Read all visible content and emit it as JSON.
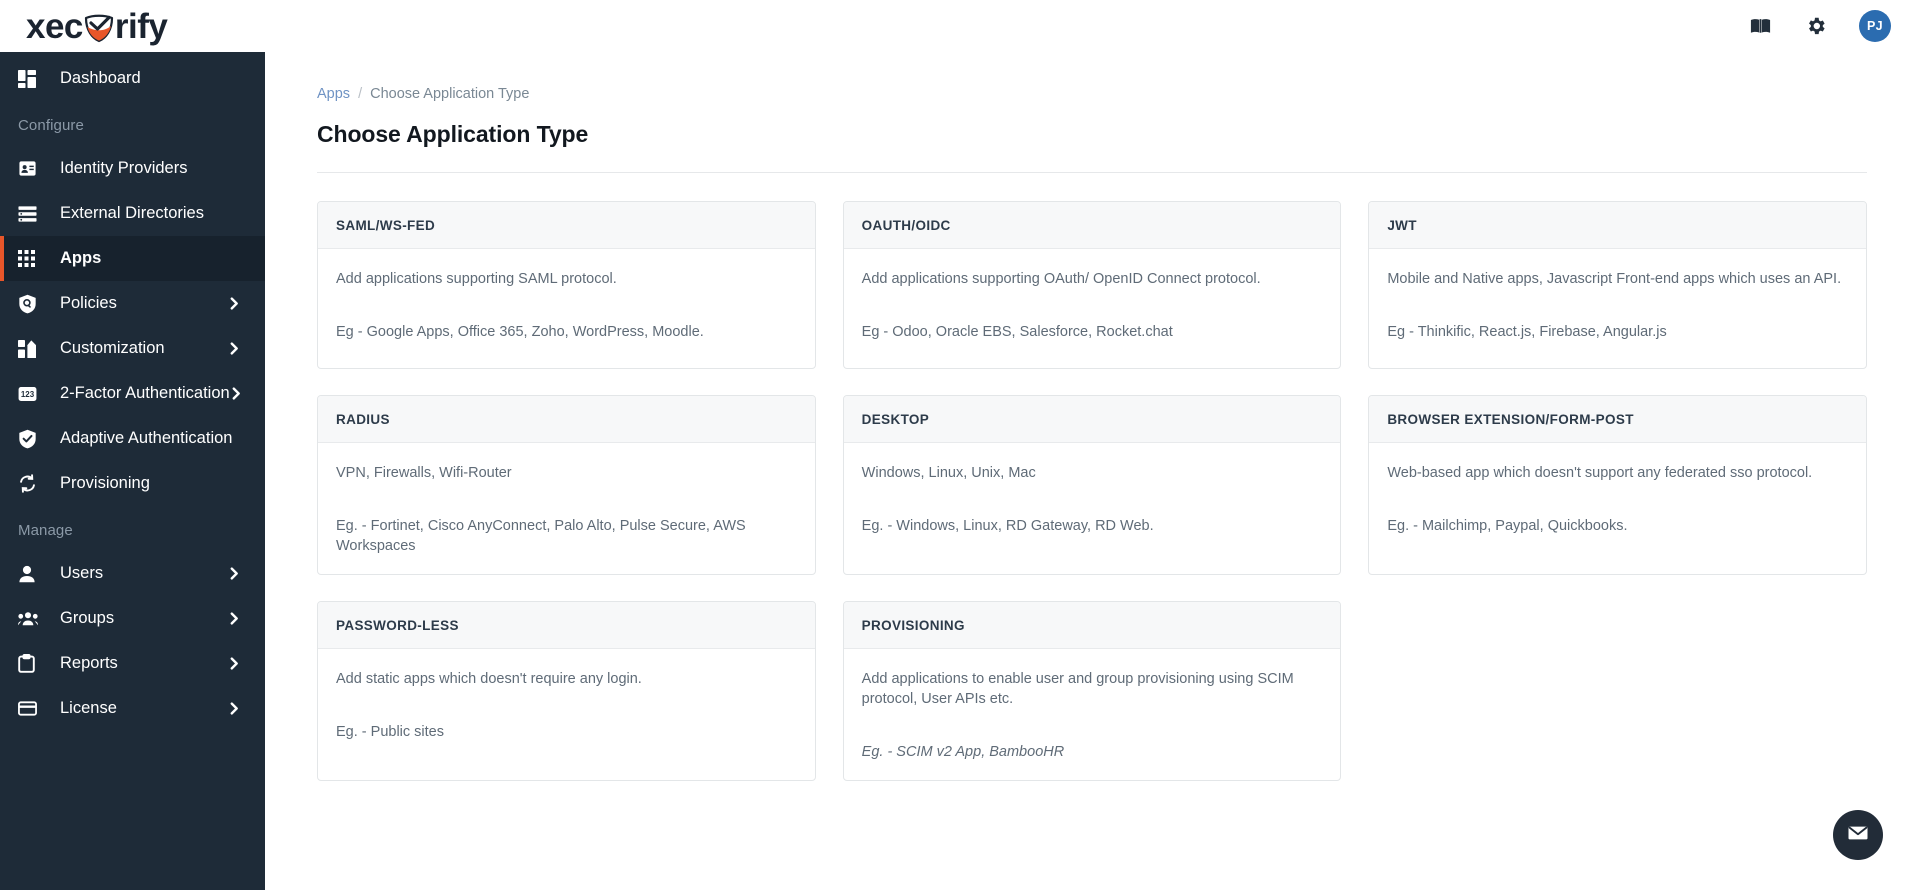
{
  "brand": {
    "name_part1": "xec",
    "name_part2": "rify",
    "shield_color": "#e8562a",
    "accent_color": "#e8562a"
  },
  "topbar": {
    "docs_icon": "book-icon",
    "settings_icon": "gear-icon",
    "avatar_initials": "PJ",
    "avatar_color": "#2b6cb0"
  },
  "sidebar": {
    "items": [
      {
        "label": "Dashboard",
        "icon": "dashboard-icon",
        "chevron": false,
        "active": false
      },
      {
        "label": "Identity Providers",
        "icon": "id-card-icon",
        "chevron": false,
        "active": false
      },
      {
        "label": "External Directories",
        "icon": "list-icon",
        "chevron": false,
        "active": false
      },
      {
        "label": "Apps",
        "icon": "grid-apps-icon",
        "chevron": false,
        "active": true
      },
      {
        "label": "Policies",
        "icon": "shield-search-icon",
        "chevron": true,
        "active": false
      },
      {
        "label": "Customization",
        "icon": "customization-icon",
        "chevron": true,
        "active": false
      },
      {
        "label": "2-Factor Authentication",
        "icon": "numeric-123-icon",
        "chevron": true,
        "active": false
      },
      {
        "label": "Adaptive Authentication",
        "icon": "shield-check-icon",
        "chevron": false,
        "active": false
      },
      {
        "label": "Provisioning",
        "icon": "sync-icon",
        "chevron": false,
        "active": false
      },
      {
        "label": "Users",
        "icon": "user-icon",
        "chevron": true,
        "active": false
      },
      {
        "label": "Groups",
        "icon": "group-icon",
        "chevron": true,
        "active": false
      },
      {
        "label": "Reports",
        "icon": "clipboard-icon",
        "chevron": true,
        "active": false
      },
      {
        "label": "License",
        "icon": "card-icon",
        "chevron": true,
        "active": false
      }
    ],
    "section_configure": "Configure",
    "section_manage": "Manage"
  },
  "breadcrumb": {
    "root": "Apps",
    "separator": "/",
    "current": "Choose Application Type"
  },
  "page": {
    "title": "Choose Application Type"
  },
  "cards": [
    {
      "title": "SAML/WS-FED",
      "description": "Add applications supporting SAML protocol.",
      "example": "Eg - Google Apps, Office 365, Zoho, WordPress, Moodle.",
      "example_italic": false
    },
    {
      "title": "OAUTH/OIDC",
      "description": "Add applications supporting OAuth/ OpenID Connect protocol.",
      "example": "Eg - Odoo, Oracle EBS, Salesforce, Rocket.chat",
      "example_italic": false
    },
    {
      "title": "JWT",
      "description": "Mobile and Native apps, Javascript Front-end apps which uses an API.",
      "example": "Eg - Thinkific, React.js, Firebase, Angular.js",
      "example_italic": false
    },
    {
      "title": "RADIUS",
      "description": "VPN, Firewalls, Wifi-Router",
      "example": "Eg. - Fortinet, Cisco AnyConnect, Palo Alto, Pulse Secure, AWS Workspaces",
      "example_italic": false
    },
    {
      "title": "DESKTOP",
      "description": "Windows, Linux, Unix, Mac",
      "example": "Eg. - Windows, Linux, RD Gateway, RD Web.",
      "example_italic": false
    },
    {
      "title": "BROWSER EXTENSION/FORM-POST",
      "description": "Web-based app which doesn't support any federated sso protocol.",
      "example": "Eg. - Mailchimp, Paypal, Quickbooks.",
      "example_italic": false
    },
    {
      "title": "PASSWORD-LESS",
      "description": "Add static apps which doesn't require any login.",
      "example": "Eg. - Public sites",
      "example_italic": false
    },
    {
      "title": "PROVISIONING",
      "description": "Add applications to enable user and group provisioning using SCIM protocol, User APIs etc.",
      "example": "Eg. - SCIM v2 App, BambooHR",
      "example_italic": true
    }
  ],
  "fab": {
    "icon": "envelope-icon",
    "color": "#222c38"
  }
}
